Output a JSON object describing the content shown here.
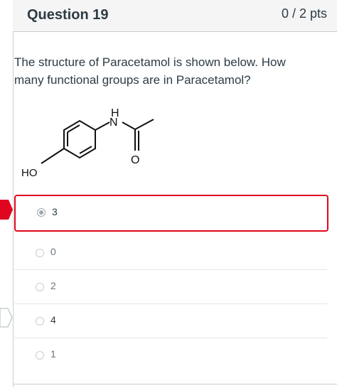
{
  "question": {
    "title": "Question 19",
    "points": "0 / 2 pts",
    "text": "The structure of Paracetamol is shown below. How many functional groups are in Paracetamol?"
  },
  "structure": {
    "label_ho": "HO",
    "label_n": "N",
    "label_h": "H",
    "label_o": "O"
  },
  "answers": [
    {
      "label": "3",
      "selected": true
    },
    {
      "label": "0",
      "selected": false
    },
    {
      "label": "2",
      "selected": false
    },
    {
      "label": "4",
      "selected": false
    },
    {
      "label": "1",
      "selected": false
    }
  ],
  "colors": {
    "incorrect_marker": "#e0061f",
    "selected_border": "#e0061f",
    "correct_marker_outline": "#c7cdd1"
  },
  "icons": {
    "incorrect_marker": "incorrect-answer-arrow-icon",
    "correct_marker": "correct-answer-arrow-icon"
  }
}
